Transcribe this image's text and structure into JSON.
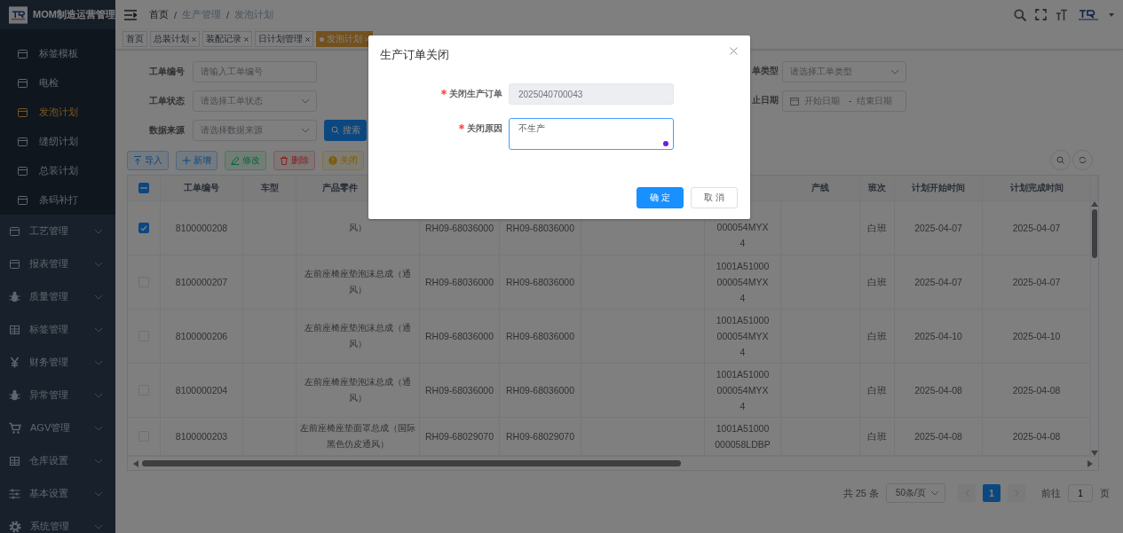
{
  "sidebar": {
    "title": "MOM制造运营管理",
    "submenu": [
      {
        "label": "标签模板",
        "selected": false
      },
      {
        "label": "电检",
        "selected": false
      },
      {
        "label": "发泡计划",
        "selected": true
      },
      {
        "label": "缝纫计划",
        "selected": false
      },
      {
        "label": "总装计划",
        "selected": false
      },
      {
        "label": "条码补打",
        "selected": false
      }
    ],
    "items": [
      {
        "label": "工艺管理",
        "expanded": false
      },
      {
        "label": "报表管理",
        "expanded": false
      },
      {
        "label": "质量管理",
        "expanded": false
      },
      {
        "label": "标签管理",
        "expanded": false
      },
      {
        "label": "财务管理",
        "expanded": false
      },
      {
        "label": "异常管理",
        "expanded": false
      },
      {
        "label": "AGV管理",
        "expanded": false
      },
      {
        "label": "仓库设置",
        "expanded": false
      },
      {
        "label": "基本设置",
        "expanded": false
      },
      {
        "label": "系统管理",
        "expanded": false
      }
    ]
  },
  "breadcrumb": [
    "首页",
    "生产管理",
    "发泡计划"
  ],
  "breadcrumb_separator": "/",
  "tabs": [
    {
      "label": "首页",
      "selected": false,
      "closable": false
    },
    {
      "label": "总装计划",
      "selected": false,
      "closable": true
    },
    {
      "label": "装配记录",
      "selected": false,
      "closable": true
    },
    {
      "label": "日计划管理",
      "selected": false,
      "closable": true
    },
    {
      "label": "发泡计划",
      "selected": true,
      "closable": true
    }
  ],
  "filters": {
    "left": [
      {
        "label": "工单编号",
        "kind": "input",
        "placeholder": "请输入工单编号"
      },
      {
        "label": "工单状态",
        "kind": "select",
        "placeholder": "请选择工单状态"
      },
      {
        "label": "数据来源",
        "kind": "select",
        "placeholder": "请选择数据来源"
      }
    ],
    "right": [
      {
        "label": "单类型",
        "kind": "select",
        "placeholder": "请选择工单类型"
      },
      {
        "label": "止日期",
        "kind": "daterange",
        "start_placeholder": "开始日期",
        "separator": "-",
        "end_placeholder": "结束日期"
      }
    ],
    "search_button": "搜索"
  },
  "toolbar": [
    {
      "label": "导入",
      "kind": "primary"
    },
    {
      "label": "新增",
      "kind": "primary"
    },
    {
      "label": "修改",
      "kind": "success"
    },
    {
      "label": "删除",
      "kind": "danger"
    },
    {
      "label": "关闭",
      "kind": "warning"
    }
  ],
  "table": {
    "header_indeterminate": true,
    "columns": [
      "工单编号",
      "车型",
      "产品零件",
      null,
      null,
      null,
      null,
      "产线",
      "班次",
      "计划开始时间",
      "计划完成时间"
    ],
    "rows": [
      {
        "selected": true,
        "cells": [
          "8100000208",
          null,
          "风）",
          "RH09-68036000",
          "RH09-68036000",
          null,
          "000054MYX4",
          null,
          "白班",
          "2025-04-07",
          "2025-04-07"
        ]
      },
      {
        "selected": false,
        "cells": [
          "8100000207",
          null,
          "左前座椅座垫泡沫总成（通风）",
          "RH09-68036000",
          "RH09-68036000",
          null,
          "1001A51000000054MYX4",
          null,
          "白班",
          "2025-04-07",
          "2025-04-07"
        ]
      },
      {
        "selected": false,
        "cells": [
          "8100000206",
          null,
          "左前座椅座垫泡沫总成（通风）",
          "RH09-68036000",
          "RH09-68036000",
          null,
          "1001A51000000054MYX4",
          null,
          "白班",
          "2025-04-10",
          "2025-04-10"
        ]
      },
      {
        "selected": false,
        "cells": [
          "8100000204",
          null,
          "左前座椅座垫泡沫总成（通风）",
          "RH09-68036000",
          "RH09-68036000",
          null,
          "1001A51000000054MYX4",
          null,
          "白班",
          "2025-04-08",
          "2025-04-08"
        ]
      },
      {
        "selected": false,
        "cells": [
          "8100000203",
          null,
          "左前座椅座垫面罩总成（国际黑色仿皮通风）",
          "RH09-68029070",
          "RH09-68029070",
          null,
          "1001A51000000058LDBP",
          null,
          "白班",
          "2025-04-08",
          "2025-04-08"
        ]
      }
    ]
  },
  "pagination": {
    "total": "共 25 条",
    "page_size": "50条/页",
    "pages": [
      {
        "label": "1",
        "selected": true
      }
    ],
    "goto_label": "前往",
    "goto_value": "1",
    "goto_suffix": "页"
  },
  "dialog": {
    "title": "生产订单关闭",
    "fields": [
      {
        "label": "关闭生产订单",
        "required": true,
        "kind": "input",
        "value": "2025040700043",
        "disabled": true,
        "focused": false
      },
      {
        "label": "关闭原因",
        "required": true,
        "kind": "textarea",
        "value": "不生产",
        "disabled": false,
        "focused": true
      }
    ],
    "buttons": [
      {
        "label": "确 定",
        "kind": "primary"
      },
      {
        "label": "取 消",
        "kind": "default"
      }
    ]
  }
}
